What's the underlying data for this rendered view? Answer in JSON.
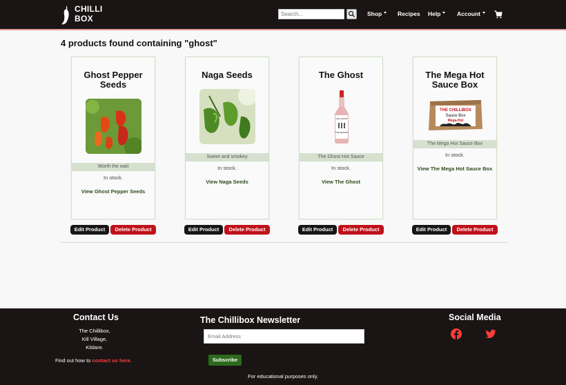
{
  "nav": {
    "logo_line1": "CHILLI",
    "logo_line2": "BOX",
    "search_placeholder": "Search...",
    "shop": "Shop",
    "recipes": "Recipes",
    "help": "Help",
    "account": "Account",
    "cart_icon": "cart-icon"
  },
  "results_heading": "4 products found containing \"ghost\"",
  "products": [
    {
      "name": "Ghost Pepper Seeds",
      "tagline": "Worth the wait",
      "stock": "In stock.",
      "link": "View Ghost Pepper Seeds"
    },
    {
      "name": "Naga Seeds",
      "tagline": "Sweet and smokey",
      "stock": "In stock.",
      "link": "View Naga Seeds"
    },
    {
      "name": "The Ghost",
      "tagline": "The Ghost Hot Sauce",
      "stock": "In stock.",
      "link": "View The Ghost"
    },
    {
      "name": "The Mega Hot Sauce Box",
      "tagline": "The Mega Hot Sauce Box",
      "stock": "In stock.",
      "link": "View The Mega Hot Sauce Box"
    }
  ],
  "buttons": {
    "edit": "Edit Product",
    "delete": "Delete Product"
  },
  "bottle_label": [
    "THE GHOST",
    "THE REAPER"
  ],
  "box_label": [
    "THE CHILLIBOX",
    "Sauce Box",
    "Mega-Hot"
  ],
  "footer": {
    "contact_heading": "Contact Us",
    "address": [
      "The Chillibox,",
      "Kill Village,",
      "Kildare."
    ],
    "find_out_text": "Find out how to ",
    "find_out_link": "contact us here",
    "find_out_end": ".",
    "newsletter_heading": "The Chillibox Newsletter",
    "email_placeholder": "Email Address",
    "subscribe": "Subscribe",
    "social_heading": "Social Media",
    "disclaimer": "For educational purposes only."
  },
  "colors": {
    "accent_red": "#c0111a",
    "dark": "#1a1414",
    "green": "#2c6a1c",
    "link_red": "#ff3b3b"
  }
}
